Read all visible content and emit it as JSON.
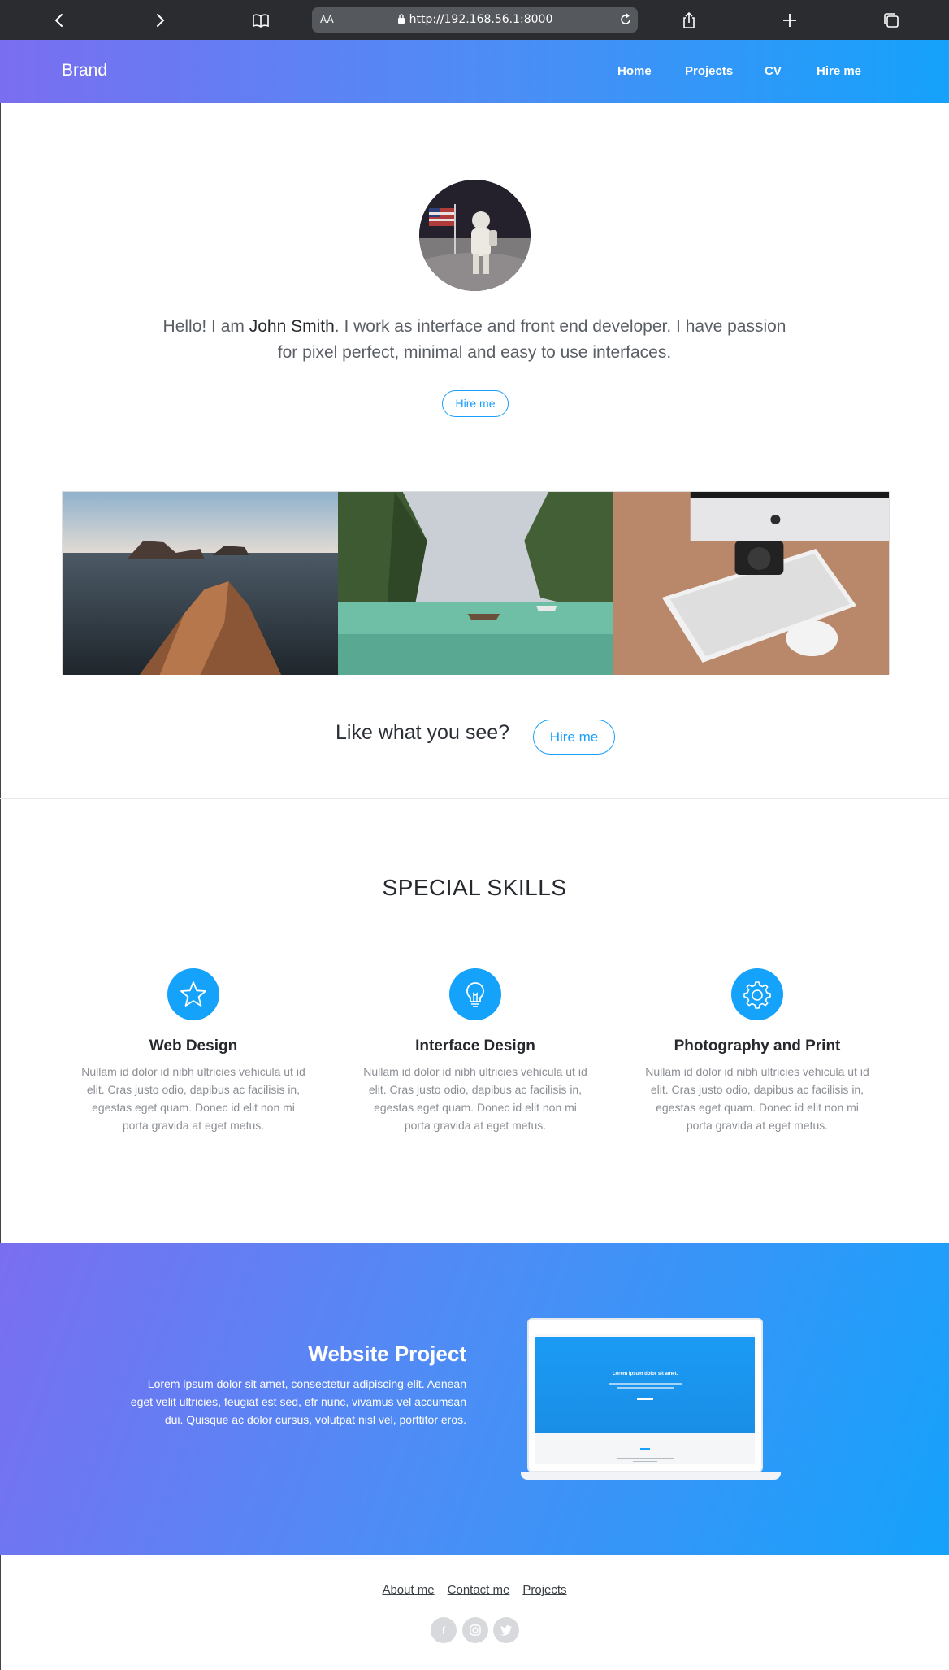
{
  "browser": {
    "url_prefix": "AA",
    "url": "http://192.168.56.1:8000",
    "icons": [
      "back-icon",
      "forward-icon",
      "bookmarks-icon",
      "lock-icon",
      "reload-icon",
      "share-icon",
      "new-tab-icon",
      "tabs-icon"
    ]
  },
  "navbar": {
    "brand": "Brand",
    "links": [
      "Home",
      "Projects",
      "CV",
      "Hire me"
    ]
  },
  "hero": {
    "intro_before": "Hello! I am ",
    "name": "John Smith",
    "intro_after": ". I work as interface and front end developer. I have passion for pixel perfect, minimal and easy to use interfaces.",
    "button": "Hire me"
  },
  "cta": {
    "text": "Like what you see?",
    "button": "Hire me"
  },
  "skills": {
    "title": "SPECIAL SKILLS",
    "items": [
      {
        "icon": "star-icon",
        "title": "Web Design",
        "text": "Nullam id dolor id nibh ultricies vehicula ut id elit. Cras justo odio, dapibus ac facilisis in, egestas eget quam. Donec id elit non mi porta gravida at eget metus."
      },
      {
        "icon": "lightbulb-icon",
        "title": "Interface Design",
        "text": "Nullam id dolor id nibh ultricies vehicula ut id elit. Cras justo odio, dapibus ac facilisis in, egestas eget quam. Donec id elit non mi porta gravida at eget metus."
      },
      {
        "icon": "gear-icon",
        "title": "Photography and Print",
        "text": "Nullam id dolor id nibh ultricies vehicula ut id elit. Cras justo odio, dapibus ac facilisis in, egestas eget quam. Donec id elit non mi porta gravida at eget metus."
      }
    ]
  },
  "project": {
    "title": "Website Project",
    "text": "Lorem ipsum dolor sit amet, consectetur adipiscing elit. Aenean eget velit ultricies, feugiat est sed, efr nunc, vivamus vel accumsan dui. Quisque ac dolor cursus, volutpat nisl vel, porttitor eros.",
    "screen_title": "Lorem ipsum dolor sit amet."
  },
  "footer": {
    "links": [
      "About me",
      "Contact me",
      "Projects"
    ],
    "social": [
      "facebook-icon",
      "instagram-icon",
      "twitter-icon"
    ]
  },
  "colors": {
    "accent": "#15a2fb",
    "gradient_start": "#7a6ef0",
    "gradient_end": "#15a2fb"
  }
}
